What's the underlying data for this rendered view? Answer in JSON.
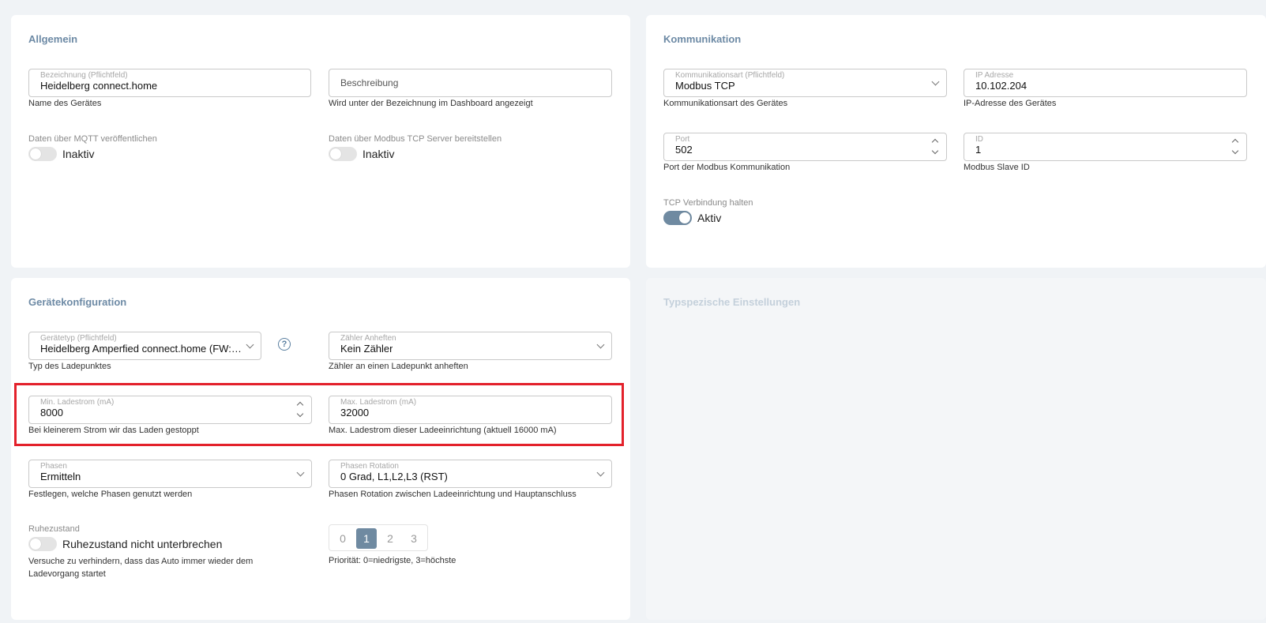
{
  "allgemein": {
    "title": "Allgemein",
    "bezeichnung": {
      "label": "Bezeichnung (Pflichtfeld)",
      "value": "Heidelberg connect.home",
      "hint": "Name des Gerätes"
    },
    "beschreibung": {
      "placeholder": "Beschreibung",
      "hint": "Wird unter der Bezeichnung im Dashboard angezeigt"
    },
    "mqtt": {
      "label": "Daten über MQTT veröffentlichen",
      "state": "Inaktiv"
    },
    "modbus_server": {
      "label": "Daten über Modbus TCP Server bereitstellen",
      "state": "Inaktiv"
    }
  },
  "kommunikation": {
    "title": "Kommunikation",
    "art": {
      "label": "Kommunikationsart (Pflichtfeld)",
      "value": "Modbus TCP",
      "hint": "Kommunikationsart des Gerätes"
    },
    "ip": {
      "label": "IP Adresse",
      "value": "10.102.204",
      "hint": "IP-Adresse des Gerätes"
    },
    "port": {
      "label": "Port",
      "value": "502",
      "hint": "Port der Modbus Kommunikation"
    },
    "id": {
      "label": "ID",
      "value": "1",
      "hint": "Modbus Slave ID"
    },
    "tcp_keep": {
      "label": "TCP Verbindung halten",
      "state": "Aktiv"
    }
  },
  "geraetekonfiguration": {
    "title": "Gerätekonfiguration",
    "geraetetyp": {
      "label": "Gerätetyp (Pflichtfeld)",
      "value": "Heidelberg Amperfied connect.home (FW:0...",
      "hint": "Typ des Ladepunktes"
    },
    "zaehler": {
      "label": "Zähler Anheften",
      "value": "Kein Zähler",
      "hint": "Zähler an einen Ladepunkt anheften"
    },
    "min_strom": {
      "label": "Min. Ladestrom (mA)",
      "value": "8000",
      "hint": "Bei kleinerem Strom wir das Laden gestoppt"
    },
    "max_strom": {
      "label": "Max. Ladestrom (mA)",
      "value": "32000",
      "hint": "Max. Ladestrom dieser Ladeeinrichtung (aktuell 16000 mA)"
    },
    "phasen": {
      "label": "Phasen",
      "value": "Ermitteln",
      "hint": "Festlegen, welche Phasen genutzt werden"
    },
    "rotation": {
      "label": "Phasen Rotation",
      "value": "0 Grad, L1,L2,L3 (RST)",
      "hint": "Phasen Rotation zwischen Ladeeinrichtung und Hauptanschluss"
    },
    "ruhezustand": {
      "label": "Ruhezustand",
      "toggle_text": "Ruhezustand nicht unterbrechen",
      "hint": "Versuche zu verhindern, dass das Auto immer wieder dem Ladevorgang startet"
    },
    "prioritaet": {
      "options": [
        "0",
        "1",
        "2",
        "3"
      ],
      "selected": "1",
      "hint": "Priorität: 0=niedrigste, 3=höchste"
    }
  },
  "typspezifisch": {
    "title": "Typspezische Einstellungen"
  },
  "colors": {
    "accent": "#6f8aa1",
    "highlight": "#e3212b",
    "title": "#6d8aa5"
  }
}
